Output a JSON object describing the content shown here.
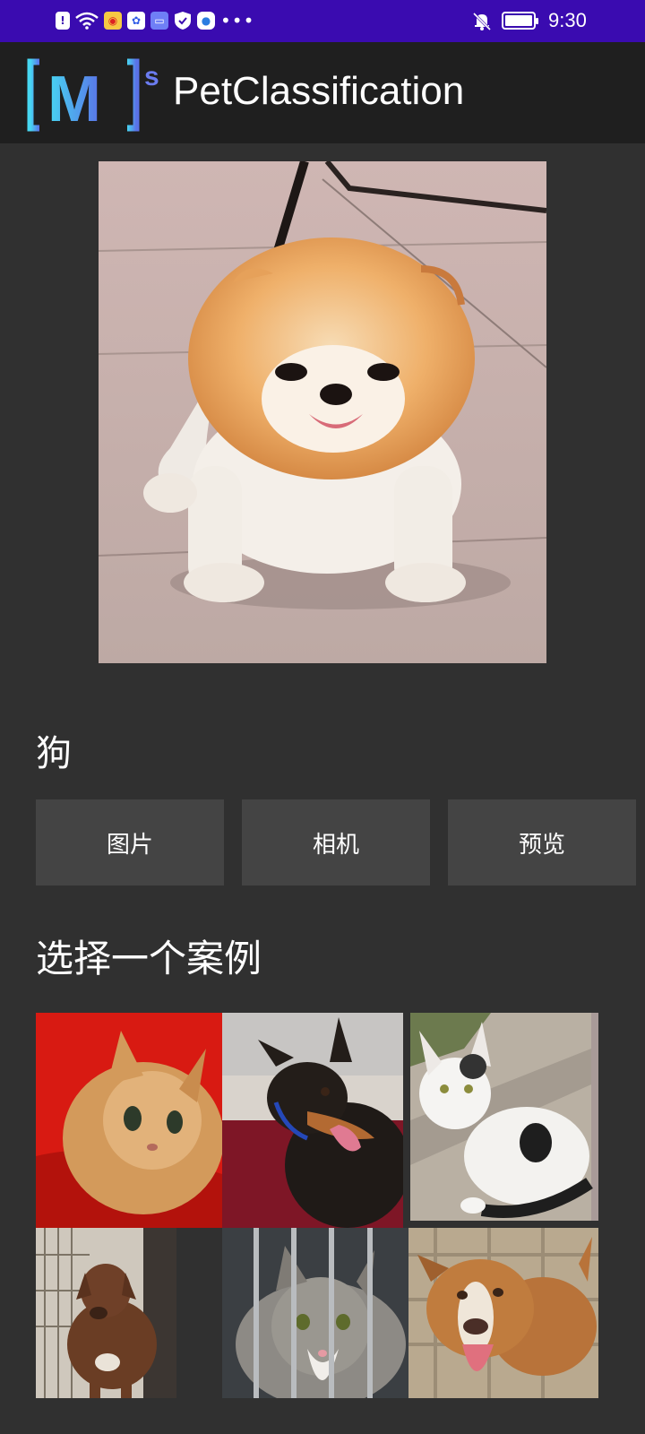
{
  "status_bar": {
    "time": "9:30",
    "left_icons": [
      "alert-icon",
      "wifi-icon",
      "weibo-icon",
      "baidu-icon",
      "app-icon",
      "shield-icon",
      "browser-icon",
      "more-dots-icon"
    ],
    "right_icons": [
      "bell-muted-icon",
      "battery-icon"
    ]
  },
  "app_bar": {
    "title": "PetClassification",
    "logo_text": "M",
    "logo_superscript": "s"
  },
  "result": {
    "label": "狗"
  },
  "buttons": {
    "picture": "图片",
    "camera": "相机",
    "preview": "预览"
  },
  "samples": {
    "title": "选择一个案例",
    "items": [
      {
        "kind": "cat"
      },
      {
        "kind": "dog"
      },
      {
        "kind": "cat"
      },
      {
        "kind": "dog"
      },
      {
        "kind": "cat"
      },
      {
        "kind": "dog"
      }
    ]
  },
  "colors": {
    "status_bar": "#3a0bb0",
    "app_bar": "#1f1f1f",
    "background": "#303030",
    "button": "#444444"
  }
}
